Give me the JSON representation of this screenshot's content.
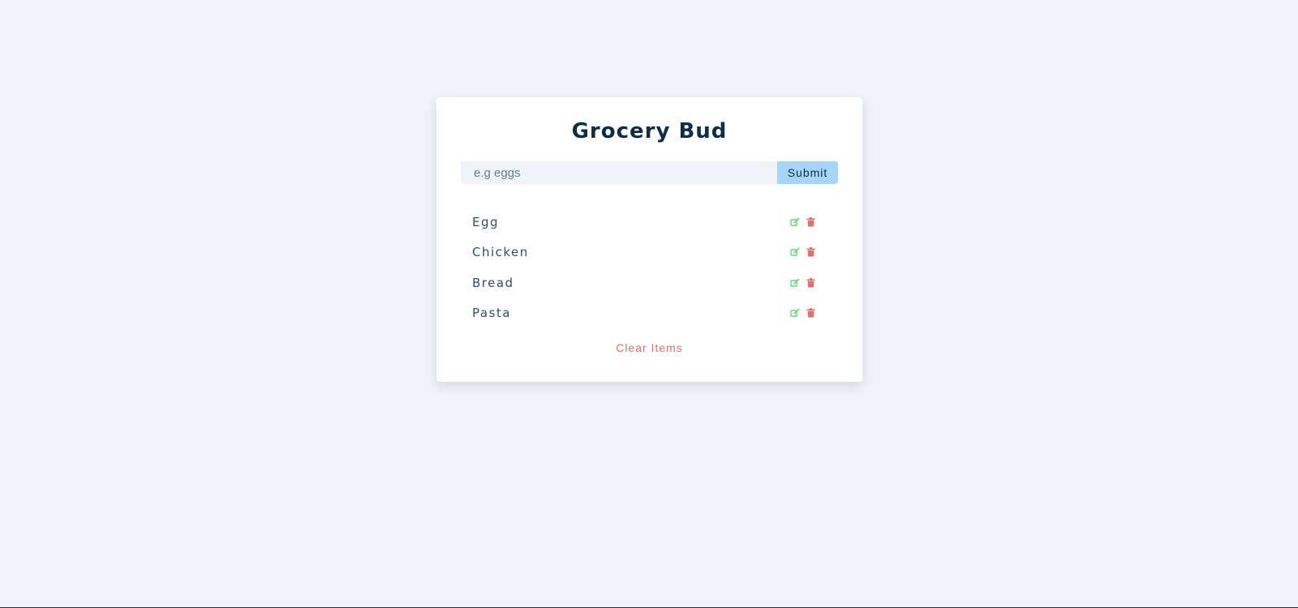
{
  "app": {
    "title": "Grocery Bud"
  },
  "form": {
    "placeholder": "e.g eggs",
    "value": "",
    "submit_label": "Submit"
  },
  "items": [
    {
      "title": "Egg",
      "edit_icon": "edit-icon",
      "delete_icon": "trash-icon"
    },
    {
      "title": "Chicken",
      "edit_icon": "edit-icon",
      "delete_icon": "trash-icon"
    },
    {
      "title": "Bread",
      "edit_icon": "edit-icon",
      "delete_icon": "trash-icon"
    },
    {
      "title": "Pasta",
      "edit_icon": "edit-icon",
      "delete_icon": "trash-icon"
    }
  ],
  "clear_label": "Clear Items",
  "colors": {
    "background": "#f0f4f8",
    "card": "#ffffff",
    "title": "#0b2f4a",
    "submit_bg": "#a5d5f8",
    "edit": "#5cdb73",
    "delete": "#e66b6b",
    "clear": "#e66b6b"
  }
}
